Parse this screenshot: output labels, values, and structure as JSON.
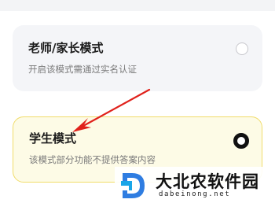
{
  "mode_options": [
    {
      "title": "老师/家长模式",
      "description": "开启该模式需通过实名认证",
      "selected": false
    },
    {
      "title": "学生模式",
      "description": "该模式部分功能不提供答案内容",
      "selected": true
    }
  ],
  "watermark": {
    "name": "大北农软件园",
    "domain": "dabeinong.net"
  },
  "colors": {
    "selected_border": "#f0dc6a",
    "selected_background": "#fdfbe6",
    "arrow": "#e0211b"
  }
}
